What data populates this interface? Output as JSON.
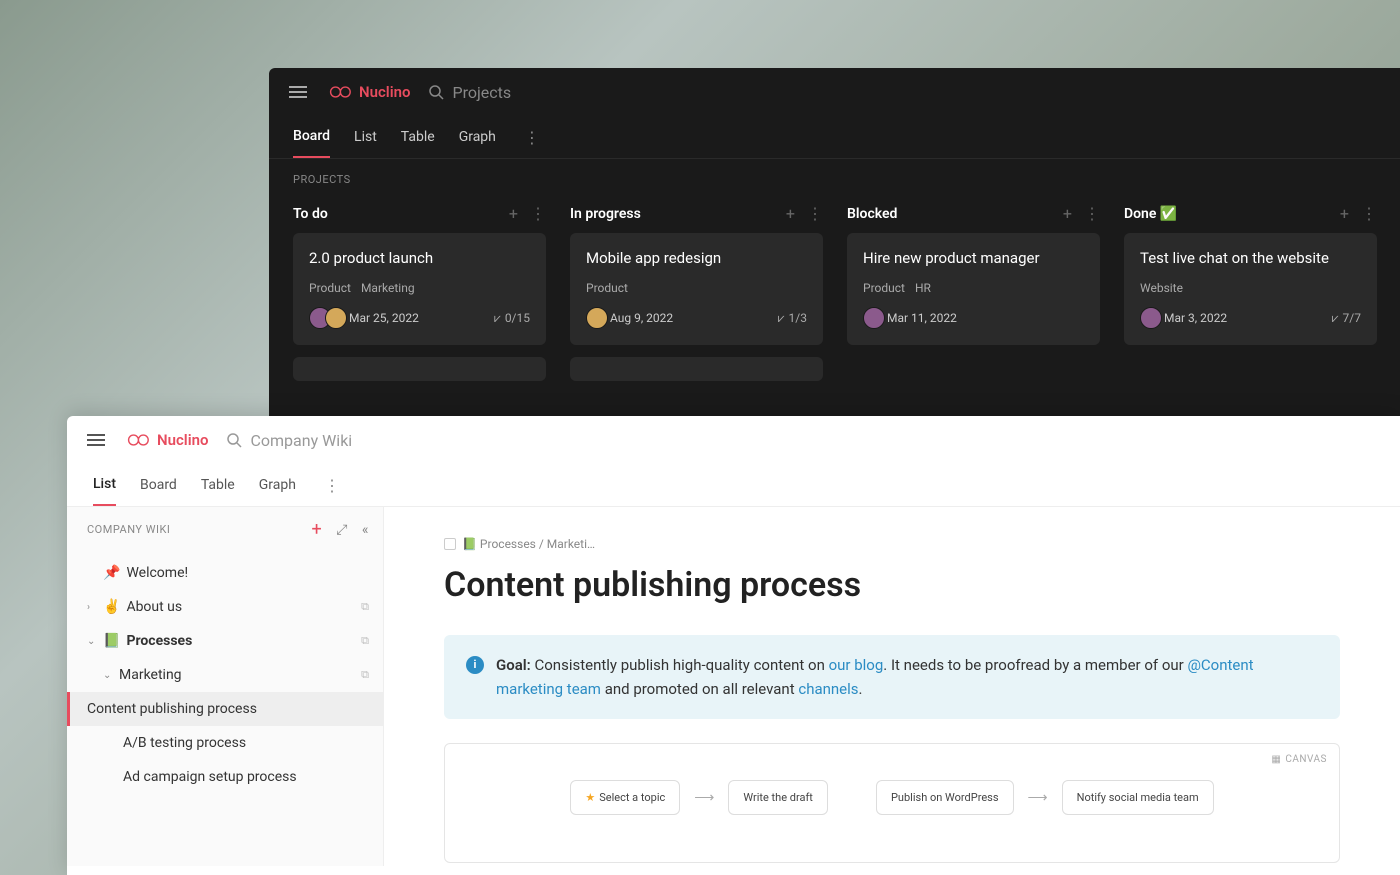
{
  "brand": "Nuclino",
  "dark": {
    "search_label": "Projects",
    "tabs": [
      "Board",
      "List",
      "Table",
      "Graph"
    ],
    "active_tab": "Board",
    "section": "PROJECTS",
    "columns": [
      {
        "title": "To do",
        "card": {
          "title": "2.0 product launch",
          "tags": [
            "Product",
            "Marketing"
          ],
          "avatars": 2,
          "date": "Mar 25, 2022",
          "progress": "0/15"
        }
      },
      {
        "title": "In progress",
        "card": {
          "title": "Mobile app redesign",
          "tags": [
            "Product"
          ],
          "avatars": 1,
          "date": "Aug 9, 2022",
          "progress": "1/3"
        }
      },
      {
        "title": "Blocked",
        "card": {
          "title": "Hire new product manager",
          "tags": [
            "Product",
            "HR"
          ],
          "avatars": 1,
          "date": "Mar 11, 2022",
          "progress": ""
        }
      },
      {
        "title": "Done ✅",
        "card": {
          "title": "Test live chat on the website",
          "tags": [
            "Website"
          ],
          "avatars": 1,
          "date": "Mar 3, 2022",
          "progress": "7/7"
        }
      }
    ]
  },
  "light": {
    "search_label": "Company Wiki",
    "tabs": [
      "List",
      "Board",
      "Table",
      "Graph"
    ],
    "active_tab": "List",
    "sidebar": {
      "label": "COMPANY WIKI",
      "items": [
        {
          "icon": "📌",
          "label": "Welcome!",
          "level": 0,
          "chevron": ""
        },
        {
          "icon": "✌️",
          "label": "About us",
          "level": 0,
          "chevron": "›"
        },
        {
          "icon": "📗",
          "label": "Processes",
          "level": 0,
          "chevron": "⌄",
          "bold": true
        },
        {
          "icon": "",
          "label": "Marketing",
          "level": 1,
          "chevron": "⌄"
        },
        {
          "icon": "",
          "label": "Content publishing process",
          "level": 2,
          "chevron": "",
          "selected": true
        },
        {
          "icon": "",
          "label": "A/B testing process",
          "level": 2,
          "chevron": ""
        },
        {
          "icon": "",
          "label": "Ad campaign setup process",
          "level": 2,
          "chevron": ""
        }
      ]
    },
    "doc": {
      "breadcrumb": "📗 Processes / Marketi…",
      "title": "Content publishing process",
      "callout": {
        "goal_label": "Goal:",
        "t1": " Consistently publish high-quality content on ",
        "link1": "our blog",
        "t2": ". It needs to be proofread by a member of our ",
        "link2": "@Content marketing team",
        "t3": " and promoted on all relevant ",
        "link3": "channels",
        "t4": "."
      },
      "canvas_label": "CANVAS",
      "flow": [
        "Select a topic",
        "Write the draft",
        "Publish on WordPress",
        "Notify social media team"
      ]
    }
  }
}
